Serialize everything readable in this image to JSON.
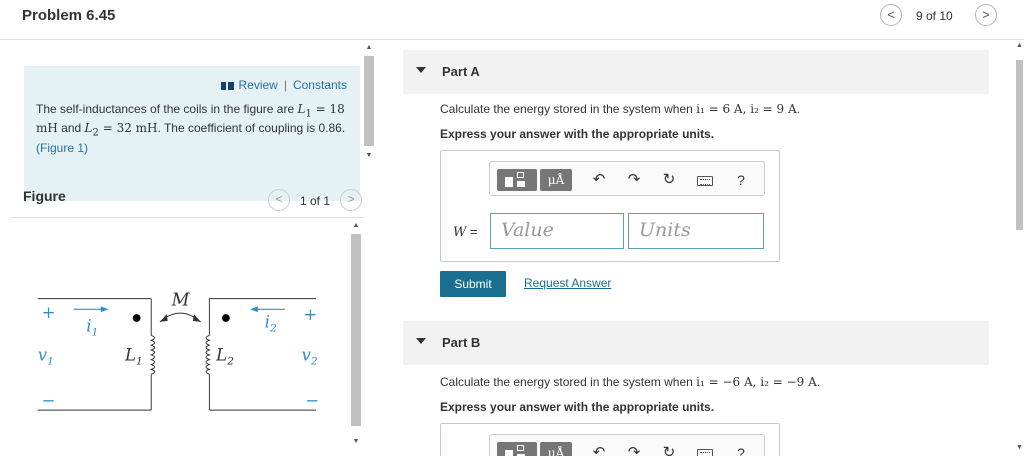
{
  "header": {
    "title": "Problem 6.45",
    "nav_prev": "<",
    "nav_next": ">",
    "count": "9 of 10"
  },
  "review": {
    "review_label": "Review",
    "separator": "|",
    "constants_label": "Constants",
    "text_intro": "The self-inductances of the coils in the figure are",
    "L1": "L",
    "L1_sub": "1",
    "L1_value": " = 18 mH",
    "and_text": " and ",
    "L2": "L",
    "L2_sub": "2",
    "L2_value": " = 32 mH",
    "text_coupling": ". The coefficient of coupling is 0.86.",
    "figure_link": "(Figure 1)"
  },
  "figure": {
    "heading": "Figure",
    "count": "1 of 1",
    "nav_prev": "<",
    "nav_next": ">",
    "labels": {
      "plus_left": "+",
      "i1": "i",
      "i1_sub": "1",
      "M": "M",
      "i2": "i",
      "i2_sub": "2",
      "plus_right": "+",
      "v1": "v",
      "v1_sub": "1",
      "L1": "L",
      "L1_sub": "1",
      "L2": "L",
      "L2_sub": "2",
      "v2": "v",
      "v2_sub": "2",
      "minus_left": "−",
      "minus_right": "−"
    }
  },
  "partA": {
    "title": "Part A",
    "question_prefix": "Calculate the energy stored in the system when ",
    "condition": "i₁ = 6 A, i₂ = 9 A",
    "question_suffix": ".",
    "instruction": "Express your answer with the appropriate units.",
    "units_btn": "μÅ",
    "help_btn": "?",
    "w_label": "W",
    "w_eq": " =",
    "value_placeholder": "Value",
    "units_placeholder": "Units",
    "submit": "Submit",
    "request": "Request Answer"
  },
  "partB": {
    "title": "Part B",
    "question_prefix": "Calculate the energy stored in the system when ",
    "condition": "i₁ = −6 A, i₂ = −9 A",
    "question_suffix": ".",
    "instruction": "Express your answer with the appropriate units.",
    "units_btn": "μÅ",
    "help_btn": "?"
  },
  "colors": {
    "accent": "#1a6e8f",
    "review_bg": "#e4f2f5",
    "link": "#2b6f9e"
  }
}
